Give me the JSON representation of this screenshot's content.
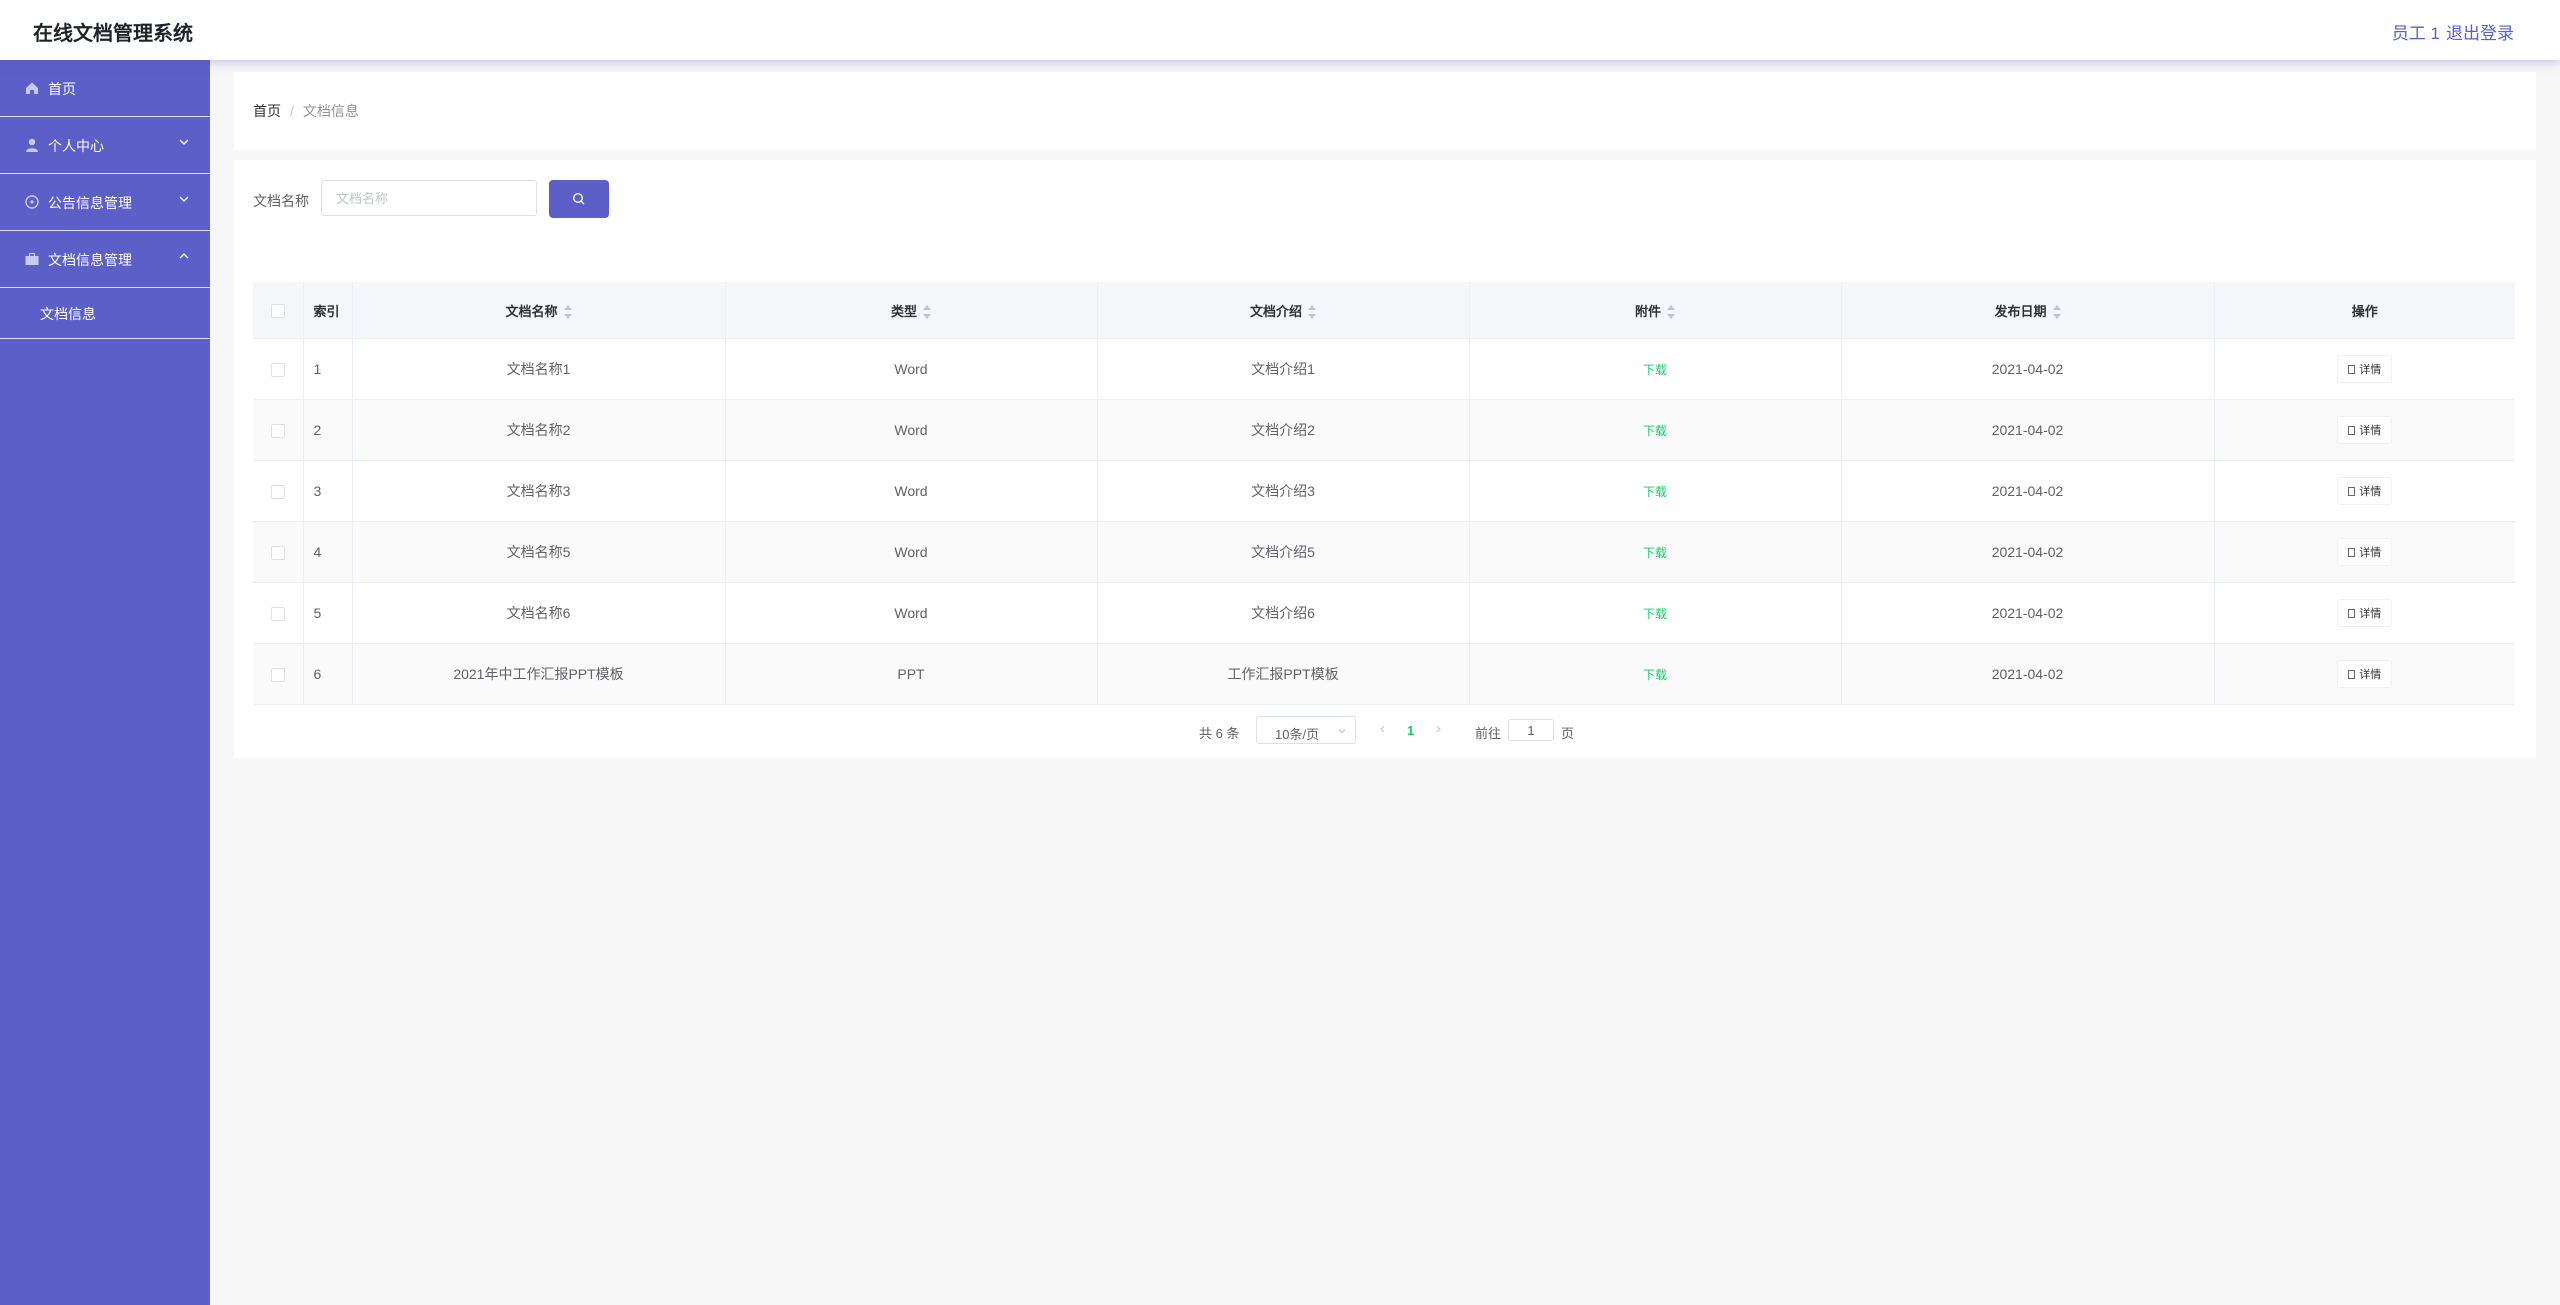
{
  "header": {
    "title": "在线文档管理系统",
    "user": "员工 1",
    "logout": "退出登录"
  },
  "sidebar": {
    "items": [
      {
        "label": "首页",
        "icon": "home-icon"
      },
      {
        "label": "个人中心",
        "icon": "user-icon",
        "expanded": false
      },
      {
        "label": "公告信息管理",
        "icon": "notice-icon",
        "expanded": false
      },
      {
        "label": "文档信息管理",
        "icon": "briefcase-icon",
        "expanded": true
      }
    ],
    "sub_item": "文档信息"
  },
  "breadcrumb": {
    "home": "首页",
    "separator": "/",
    "current": "文档信息"
  },
  "search": {
    "label": "文档名称",
    "placeholder": "文档名称",
    "value": ""
  },
  "table": {
    "columns": {
      "index": "索引",
      "name": "文档名称",
      "type": "类型",
      "intro": "文档介绍",
      "attachment": "附件",
      "date": "发布日期",
      "action": "操作"
    },
    "rows": [
      {
        "index": "1",
        "name": "文档名称1",
        "type": "Word",
        "intro": "文档介绍1",
        "attachment": "下载",
        "date": "2021-04-02",
        "action": "详情"
      },
      {
        "index": "2",
        "name": "文档名称2",
        "type": "Word",
        "intro": "文档介绍2",
        "attachment": "下载",
        "date": "2021-04-02",
        "action": "详情"
      },
      {
        "index": "3",
        "name": "文档名称3",
        "type": "Word",
        "intro": "文档介绍3",
        "attachment": "下载",
        "date": "2021-04-02",
        "action": "详情"
      },
      {
        "index": "4",
        "name": "文档名称5",
        "type": "Word",
        "intro": "文档介绍5",
        "attachment": "下载",
        "date": "2021-04-02",
        "action": "详情"
      },
      {
        "index": "5",
        "name": "文档名称6",
        "type": "Word",
        "intro": "文档介绍6",
        "attachment": "下载",
        "date": "2021-04-02",
        "action": "详情"
      },
      {
        "index": "6",
        "name": "2021年中工作汇报PPT模板",
        "type": "PPT",
        "intro": "工作汇报PPT模板",
        "attachment": "下载",
        "date": "2021-04-02",
        "action": "详情"
      }
    ]
  },
  "pagination": {
    "total": "共 6 条",
    "page_size": "10条/页",
    "current_page": "1",
    "goto_label": "前往",
    "goto_value": "1",
    "page_suffix": "页"
  },
  "colors": {
    "accent": "#5b5fc7",
    "success": "#13ce66"
  }
}
